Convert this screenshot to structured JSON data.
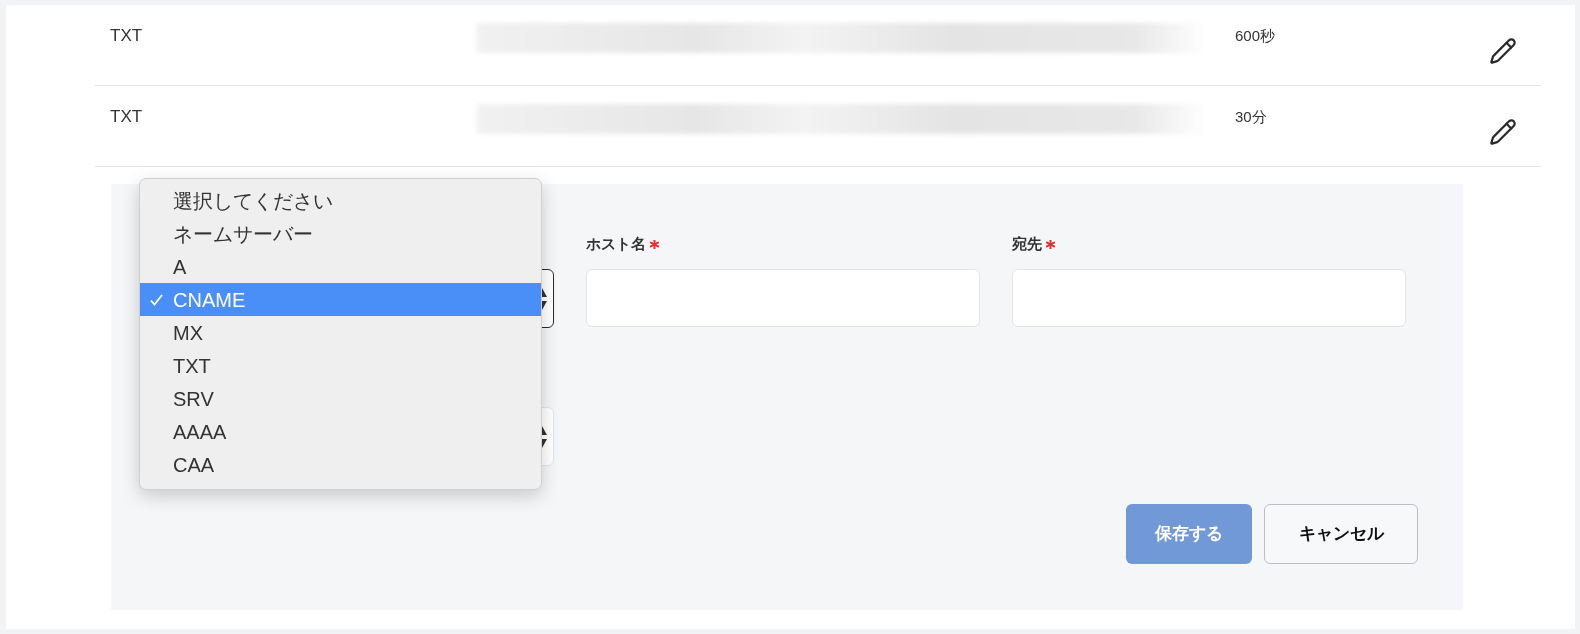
{
  "records": [
    {
      "type": "TXT",
      "ttl": "600秒"
    },
    {
      "type": "TXT",
      "ttl": "30分"
    }
  ],
  "form": {
    "selects": [
      {
        "focused": true
      },
      {
        "focused": false
      }
    ],
    "fields": [
      {
        "label": "ホスト名",
        "required": true
      },
      {
        "label": "宛先",
        "required": true
      }
    ],
    "buttons": [
      {
        "label": "保存する",
        "kind": "primary",
        "disabled": true
      },
      {
        "label": "キャンセル",
        "kind": "secondary",
        "disabled": false
      }
    ]
  },
  "record_type_dropdown": {
    "options": [
      {
        "label": "選択してください",
        "selected": false
      },
      {
        "label": "ネームサーバー",
        "selected": false
      },
      {
        "label": "A",
        "selected": false
      },
      {
        "label": "CNAME",
        "selected": true
      },
      {
        "label": "MX",
        "selected": false
      },
      {
        "label": "TXT",
        "selected": false
      },
      {
        "label": "SRV",
        "selected": false
      },
      {
        "label": "AAAA",
        "selected": false
      },
      {
        "label": "CAA",
        "selected": false
      }
    ]
  }
}
